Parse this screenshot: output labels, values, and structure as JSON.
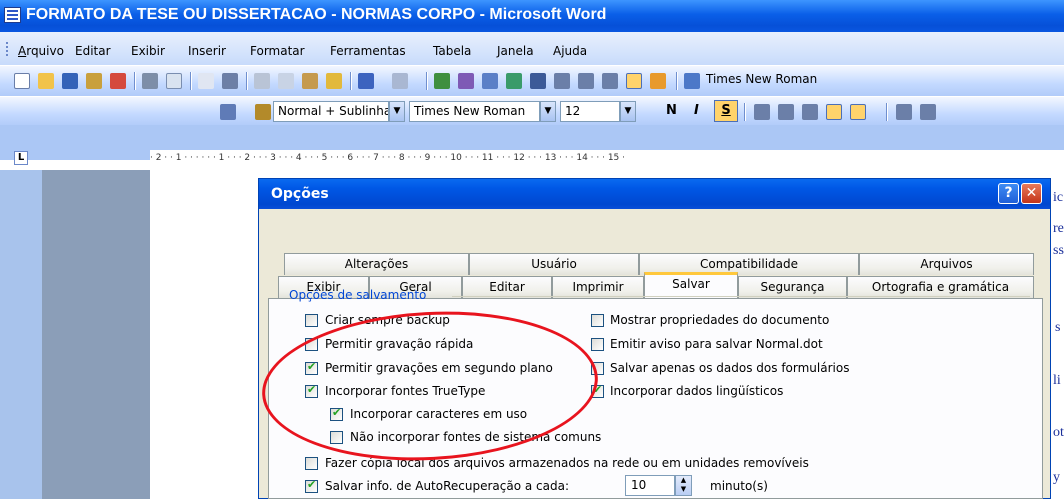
{
  "window": {
    "title": "FORMATO DA TESE OU DISSERTACAO - NORMAS CORPO - Microsoft Word"
  },
  "menu": [
    "Arquivo",
    "Editar",
    "Exibir",
    "Inserir",
    "Formatar",
    "Ferramentas",
    "Tabela",
    "Janela",
    "Ajuda"
  ],
  "toolbar": {
    "font_top": "Times New Roman",
    "style": "Normal + Sublinhadc",
    "font": "Times New Roman",
    "size": "12",
    "bold": "N",
    "italic": "I",
    "underline": "S"
  },
  "ruler": {
    "marks": "· 2 · · 1 · · ·  · · · 1 · · · 2 · · · 3 · · · 4 · · · 5 · · · 6 · · · 7 · · · 8 · · · 9 · · · 10 · · · 11 · · · 12 · · · 13 · · · 14 · · · 15 ·"
  },
  "dialog": {
    "title": "Opções",
    "help": "?",
    "close": "✕",
    "tabs_row1": [
      "Alterações",
      "Usuário",
      "Compatibilidade",
      "Arquivos"
    ],
    "tabs_row2": [
      "Exibir",
      "Geral",
      "Editar",
      "Imprimir",
      "Salvar",
      "Segurança",
      "Ortografia e gramática"
    ],
    "active_tab": "Salvar",
    "group": "Opções de salvamento",
    "left_options": [
      {
        "label": "Criar sempre backup",
        "checked": false
      },
      {
        "label": "Permitir gravação rápida",
        "checked": false
      },
      {
        "label": "Permitir gravações em segundo plano",
        "checked": true
      },
      {
        "label": "Incorporar fontes TrueType",
        "checked": true
      },
      {
        "label": "Incorporar caracteres em uso",
        "checked": true
      },
      {
        "label": "Não incorporar fontes de sistema comuns",
        "checked": false
      }
    ],
    "right_options": [
      {
        "label": "Mostrar propriedades do documento",
        "checked": false
      },
      {
        "label": "Emitir aviso para salvar Normal.dot",
        "checked": false
      },
      {
        "label": "Salvar apenas os dados dos formulários",
        "checked": false
      },
      {
        "label": "Incorporar dados lingüísticos",
        "checked": true
      }
    ],
    "copy_local": {
      "label": "Fazer cópia local dos arquivos armazenados na rede ou em unidades removíveis",
      "checked": false
    },
    "autorecover": {
      "label": "Salvar info. de AutoRecuperação a cada:",
      "checked": true,
      "value": "10",
      "unit": "minuto(s)"
    }
  },
  "page_fragments": [
    "ic",
    "re",
    "ss",
    "s",
    "li",
    "ot",
    "y"
  ],
  "colors": {
    "titlebar": "#0a5fe8",
    "dialog_title": "#0058e6",
    "annotation": "#e8141e",
    "group_label": "#0046d5"
  }
}
